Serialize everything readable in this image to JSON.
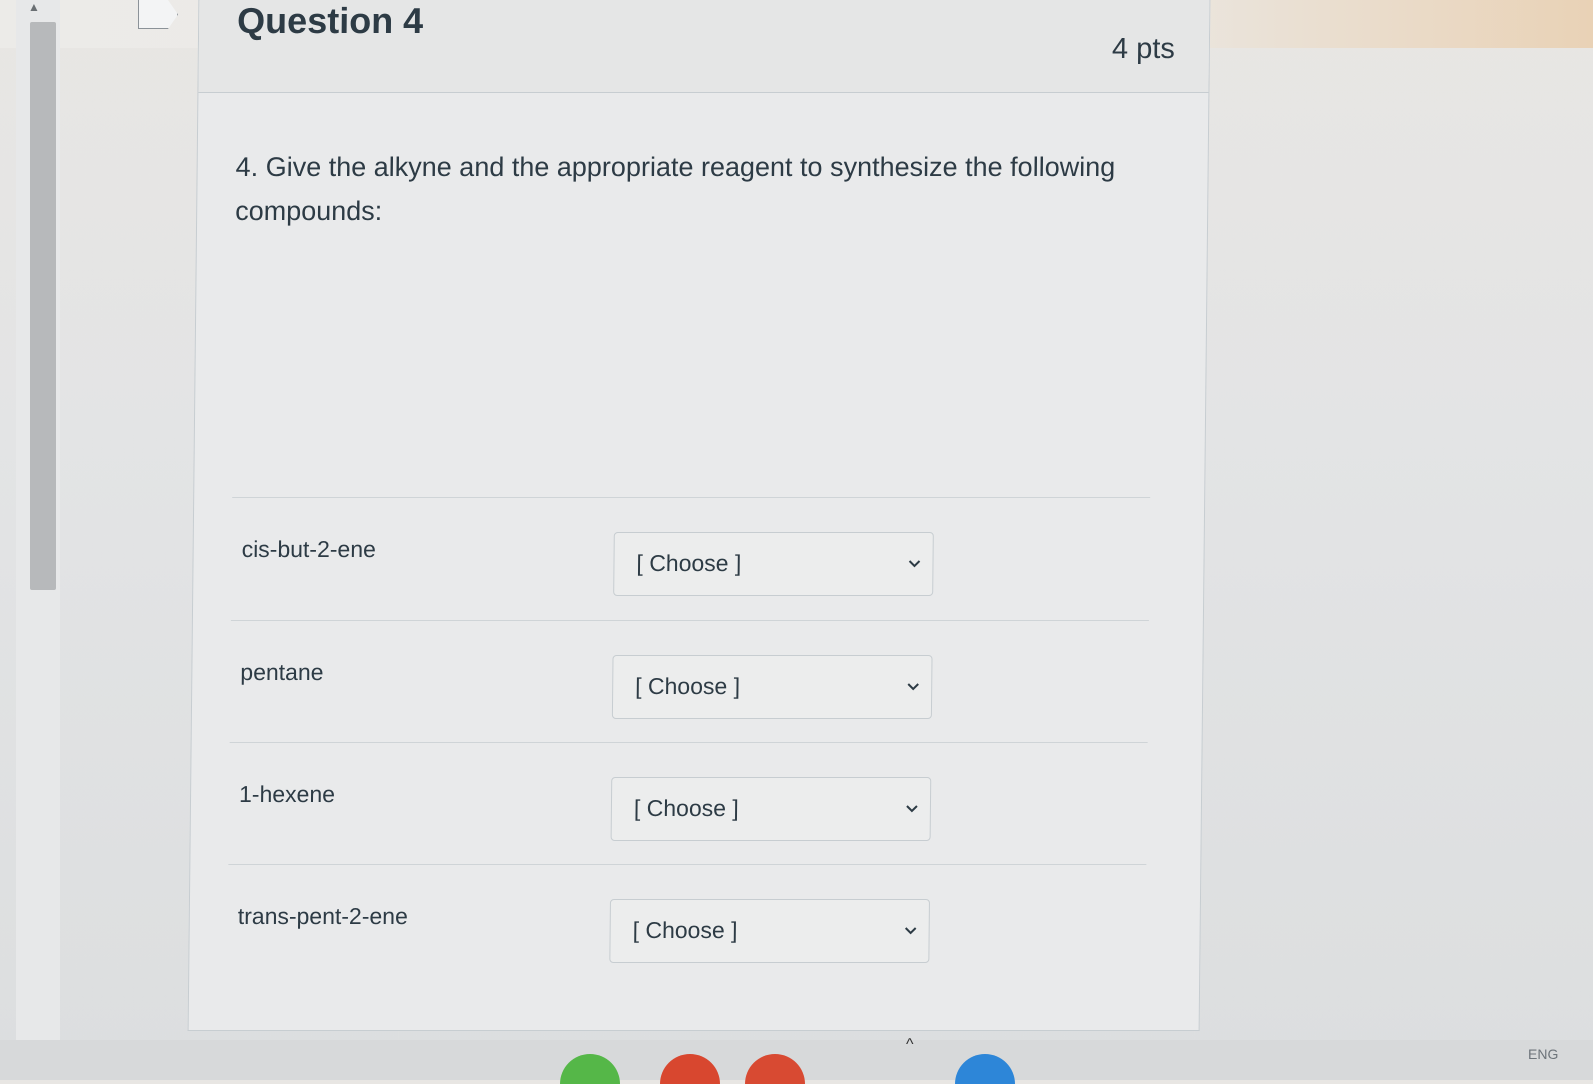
{
  "question": {
    "title": "Question 4",
    "points": "4 pts",
    "prompt": "4. Give the alkyne and the appropriate reagent to synthesize the following compounds:"
  },
  "answers": [
    {
      "label": "cis-but-2-ene",
      "selected": "[ Choose ]"
    },
    {
      "label": "pentane",
      "selected": "[ Choose ]"
    },
    {
      "label": "1-hexene",
      "selected": "[ Choose ]"
    },
    {
      "label": "trans-pent-2-ene",
      "selected": "[ Choose ]"
    }
  ],
  "icons": {
    "flag": "flag-icon",
    "dropdown": "chevron-down-icon",
    "scroll_up": "arrow-up-icon",
    "scroll_down": "arrow-down-icon",
    "tray_up": "chevron-up-icon"
  },
  "taskbar": {
    "tray_language": "ENG"
  },
  "colors": {
    "text": "#2d3b45",
    "border": "#c7cdd1",
    "card_background": "#e9eaeb"
  }
}
